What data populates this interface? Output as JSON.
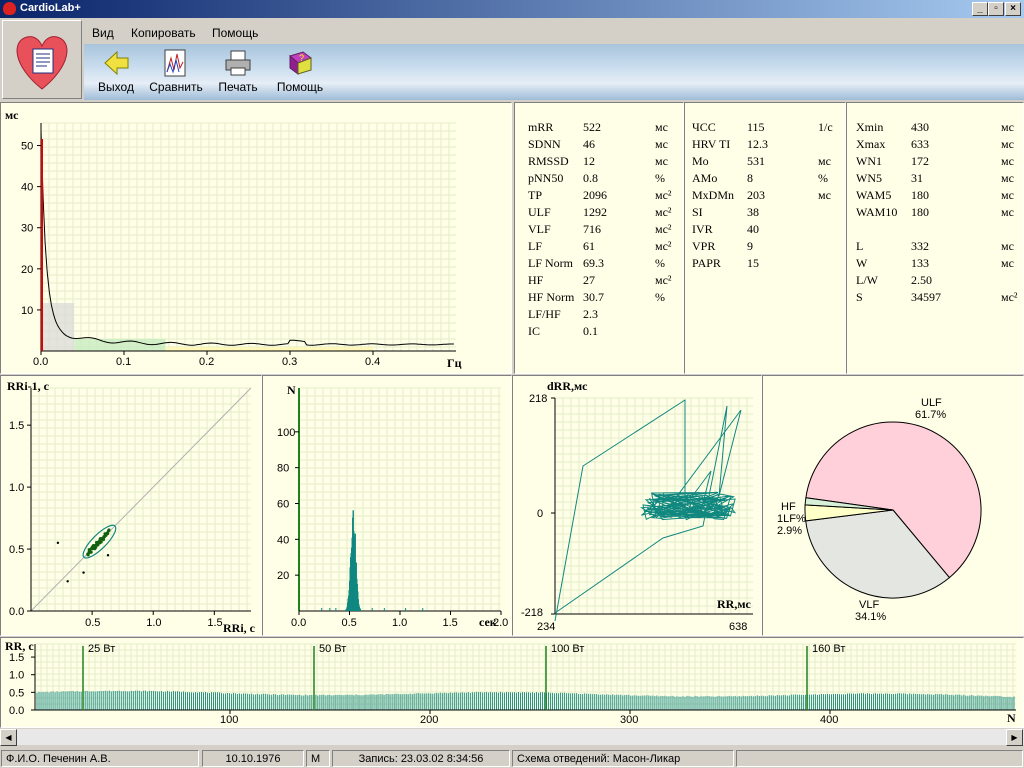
{
  "window": {
    "title": "CardioLab+"
  },
  "menu": [
    "Вид",
    "Копировать",
    "Помощь"
  ],
  "toolbar": [
    {
      "label": "Выход",
      "icon": "exit-arrow-icon"
    },
    {
      "label": "Сравнить",
      "icon": "compare-chart-icon"
    },
    {
      "label": "Печать",
      "icon": "printer-icon"
    },
    {
      "label": "Помощь",
      "icon": "help-book-icon"
    }
  ],
  "spectrum": {
    "ylabel": "мс",
    "xlabel": "Гц",
    "yticks": [
      "50",
      "40",
      "30",
      "20",
      "10"
    ],
    "xticks": [
      "0.0",
      "0.1",
      "0.2",
      "0.3",
      "0.4"
    ]
  },
  "stats1": [
    {
      "name": "mRR",
      "value": "522",
      "unit": "мс"
    },
    {
      "name": "SDNN",
      "value": "46",
      "unit": "мс"
    },
    {
      "name": "RMSSD",
      "value": "12",
      "unit": "мс"
    },
    {
      "name": "pNN50",
      "value": "0.8",
      "unit": "%"
    },
    {
      "name": "TP",
      "value": "2096",
      "unit": "мс²"
    },
    {
      "name": "ULF",
      "value": "1292",
      "unit": "мс²"
    },
    {
      "name": "VLF",
      "value": "716",
      "unit": "мс²"
    },
    {
      "name": "LF",
      "value": "61",
      "unit": "мс²"
    },
    {
      "name": "LF Norm",
      "value": "69.3",
      "unit": "%"
    },
    {
      "name": "HF",
      "value": "27",
      "unit": "мс²"
    },
    {
      "name": "HF Norm",
      "value": "30.7",
      "unit": "%"
    },
    {
      "name": "LF/HF",
      "value": "2.3",
      "unit": ""
    },
    {
      "name": "IC",
      "value": "0.1",
      "unit": ""
    }
  ],
  "stats2": [
    {
      "name": "ЧСС",
      "value": "115",
      "unit": "1/с"
    },
    {
      "name": "HRV TI",
      "value": "12.3",
      "unit": ""
    },
    {
      "name": "Mo",
      "value": "531",
      "unit": "мс"
    },
    {
      "name": "AMo",
      "value": "8",
      "unit": "%"
    },
    {
      "name": "MxDMn",
      "value": "203",
      "unit": "мс"
    },
    {
      "name": "SI",
      "value": "38",
      "unit": ""
    },
    {
      "name": "IVR",
      "value": "40",
      "unit": ""
    },
    {
      "name": "VPR",
      "value": "9",
      "unit": ""
    },
    {
      "name": "PAPR",
      "value": "15",
      "unit": ""
    }
  ],
  "stats3": [
    {
      "name": "Xmin",
      "value": "430",
      "unit": "мс"
    },
    {
      "name": "Xmax",
      "value": "633",
      "unit": "мс"
    },
    {
      "name": "WN1",
      "value": "172",
      "unit": "мс"
    },
    {
      "name": "WN5",
      "value": "31",
      "unit": "мс"
    },
    {
      "name": "WAM5",
      "value": "180",
      "unit": "мс"
    },
    {
      "name": "WAM10",
      "value": "180",
      "unit": "мс"
    },
    {
      "name": "",
      "value": "",
      "unit": ""
    },
    {
      "name": "L",
      "value": "332",
      "unit": "мс"
    },
    {
      "name": "W",
      "value": "133",
      "unit": "мс"
    },
    {
      "name": "L/W",
      "value": "2.50",
      "unit": ""
    },
    {
      "name": "S",
      "value": "34597",
      "unit": "мс²"
    }
  ],
  "scatter": {
    "ylabel": "RRi-1, с",
    "xlabel": "RRi, с",
    "yticks": [
      "1.5",
      "1.0",
      "0.5",
      "0.0"
    ],
    "xticks": [
      "0.5",
      "1.0",
      "1.5"
    ]
  },
  "histogram": {
    "ylabel": "N",
    "xlabel": "сек",
    "yticks": [
      "100",
      "80",
      "60",
      "40",
      "20"
    ],
    "xticks": [
      "0.0",
      "0.5",
      "1.0",
      "1.5",
      "2.0"
    ]
  },
  "diffplot": {
    "ylabel": "dRR,мс",
    "xlabel": "RR,мс",
    "ytop": "218",
    "ymid": "0",
    "ybottom": "-218",
    "xleft": "234",
    "xright": "638"
  },
  "chart_data": {
    "type": "pie",
    "slices": [
      {
        "name": "ULF",
        "pct_label": "61.7%",
        "value": 61.7,
        "color": "#ffd0da"
      },
      {
        "name": "VLF",
        "pct_label": "34.1%",
        "value": 34.1,
        "color": "#e4e6e2"
      },
      {
        "name": "LF",
        "pct_label": "",
        "value": 2.9,
        "color": "#ffffc8"
      },
      {
        "name": "HF",
        "pct_label": "",
        "value": 1.3,
        "color": "#d8f0d8"
      }
    ],
    "left_labels": [
      "HF",
      "1LF%",
      "2.9%"
    ]
  },
  "rhythm": {
    "ylabel": "RR, с",
    "yticks": [
      "1.5",
      "1.0",
      "0.5",
      "0.0"
    ],
    "xticks": [
      "100",
      "200",
      "300",
      "400"
    ],
    "xlabel": "N",
    "markers": [
      "25 Вт",
      "50 Вт",
      "100 Вт",
      "160 Вт"
    ]
  },
  "status": {
    "name": "Ф.И.О. Печенин А.В.",
    "dob": "10.10.1976",
    "sex": "М",
    "record": "Запись: 23.03.02 8:34:56",
    "scheme": "Схема отведений: Масон-Ликар"
  },
  "colors": {
    "plot_bg": "#ffffe8",
    "grid": "#e6ecc8",
    "trace_teal": "#108880",
    "marker_green": "#208020"
  }
}
